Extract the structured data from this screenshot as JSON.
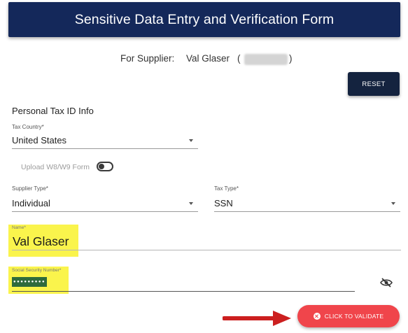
{
  "header": {
    "title": "Sensitive Data Entry and Verification Form"
  },
  "supplier": {
    "label": "For Supplier:",
    "name": "Val Glaser",
    "paren_open": "(",
    "paren_close": ")"
  },
  "reset_label": "RESET",
  "section_title": "Personal Tax ID Info",
  "tax_country": {
    "label": "Tax Country*",
    "value": "United States"
  },
  "upload": {
    "label": "Upload W8/W9 Form",
    "toggle_on": false
  },
  "supplier_type": {
    "label": "Supplier Type*",
    "value": "Individual"
  },
  "tax_type": {
    "label": "Tax Type*",
    "value": "SSN"
  },
  "name_field": {
    "label": "Name*",
    "value": "Val Glaser"
  },
  "ssn_field": {
    "label": "Social Security Number*",
    "value": "●●●●●●●●●"
  },
  "validate_label": "CLICK TO VALIDATE",
  "colors": {
    "header_bg": "#14285a",
    "reset_bg": "#14233f",
    "validate_bg": "#f0454b",
    "highlight": "#faf44c",
    "arrow": "#cc1f1f"
  },
  "icons": [
    "chevron-down-icon",
    "eye-off-icon",
    "close-circle-icon",
    "red-arrow"
  ]
}
